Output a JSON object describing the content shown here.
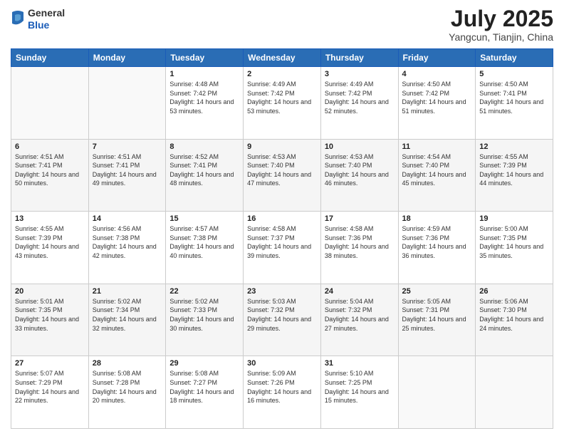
{
  "header": {
    "logo_general": "General",
    "logo_blue": "Blue",
    "month": "July 2025",
    "location": "Yangcun, Tianjin, China"
  },
  "days_of_week": [
    "Sunday",
    "Monday",
    "Tuesday",
    "Wednesday",
    "Thursday",
    "Friday",
    "Saturday"
  ],
  "weeks": [
    [
      {
        "day": "",
        "info": ""
      },
      {
        "day": "",
        "info": ""
      },
      {
        "day": "1",
        "info": "Sunrise: 4:48 AM\nSunset: 7:42 PM\nDaylight: 14 hours and 53 minutes."
      },
      {
        "day": "2",
        "info": "Sunrise: 4:49 AM\nSunset: 7:42 PM\nDaylight: 14 hours and 53 minutes."
      },
      {
        "day": "3",
        "info": "Sunrise: 4:49 AM\nSunset: 7:42 PM\nDaylight: 14 hours and 52 minutes."
      },
      {
        "day": "4",
        "info": "Sunrise: 4:50 AM\nSunset: 7:42 PM\nDaylight: 14 hours and 51 minutes."
      },
      {
        "day": "5",
        "info": "Sunrise: 4:50 AM\nSunset: 7:41 PM\nDaylight: 14 hours and 51 minutes."
      }
    ],
    [
      {
        "day": "6",
        "info": "Sunrise: 4:51 AM\nSunset: 7:41 PM\nDaylight: 14 hours and 50 minutes."
      },
      {
        "day": "7",
        "info": "Sunrise: 4:51 AM\nSunset: 7:41 PM\nDaylight: 14 hours and 49 minutes."
      },
      {
        "day": "8",
        "info": "Sunrise: 4:52 AM\nSunset: 7:41 PM\nDaylight: 14 hours and 48 minutes."
      },
      {
        "day": "9",
        "info": "Sunrise: 4:53 AM\nSunset: 7:40 PM\nDaylight: 14 hours and 47 minutes."
      },
      {
        "day": "10",
        "info": "Sunrise: 4:53 AM\nSunset: 7:40 PM\nDaylight: 14 hours and 46 minutes."
      },
      {
        "day": "11",
        "info": "Sunrise: 4:54 AM\nSunset: 7:40 PM\nDaylight: 14 hours and 45 minutes."
      },
      {
        "day": "12",
        "info": "Sunrise: 4:55 AM\nSunset: 7:39 PM\nDaylight: 14 hours and 44 minutes."
      }
    ],
    [
      {
        "day": "13",
        "info": "Sunrise: 4:55 AM\nSunset: 7:39 PM\nDaylight: 14 hours and 43 minutes."
      },
      {
        "day": "14",
        "info": "Sunrise: 4:56 AM\nSunset: 7:38 PM\nDaylight: 14 hours and 42 minutes."
      },
      {
        "day": "15",
        "info": "Sunrise: 4:57 AM\nSunset: 7:38 PM\nDaylight: 14 hours and 40 minutes."
      },
      {
        "day": "16",
        "info": "Sunrise: 4:58 AM\nSunset: 7:37 PM\nDaylight: 14 hours and 39 minutes."
      },
      {
        "day": "17",
        "info": "Sunrise: 4:58 AM\nSunset: 7:36 PM\nDaylight: 14 hours and 38 minutes."
      },
      {
        "day": "18",
        "info": "Sunrise: 4:59 AM\nSunset: 7:36 PM\nDaylight: 14 hours and 36 minutes."
      },
      {
        "day": "19",
        "info": "Sunrise: 5:00 AM\nSunset: 7:35 PM\nDaylight: 14 hours and 35 minutes."
      }
    ],
    [
      {
        "day": "20",
        "info": "Sunrise: 5:01 AM\nSunset: 7:35 PM\nDaylight: 14 hours and 33 minutes."
      },
      {
        "day": "21",
        "info": "Sunrise: 5:02 AM\nSunset: 7:34 PM\nDaylight: 14 hours and 32 minutes."
      },
      {
        "day": "22",
        "info": "Sunrise: 5:02 AM\nSunset: 7:33 PM\nDaylight: 14 hours and 30 minutes."
      },
      {
        "day": "23",
        "info": "Sunrise: 5:03 AM\nSunset: 7:32 PM\nDaylight: 14 hours and 29 minutes."
      },
      {
        "day": "24",
        "info": "Sunrise: 5:04 AM\nSunset: 7:32 PM\nDaylight: 14 hours and 27 minutes."
      },
      {
        "day": "25",
        "info": "Sunrise: 5:05 AM\nSunset: 7:31 PM\nDaylight: 14 hours and 25 minutes."
      },
      {
        "day": "26",
        "info": "Sunrise: 5:06 AM\nSunset: 7:30 PM\nDaylight: 14 hours and 24 minutes."
      }
    ],
    [
      {
        "day": "27",
        "info": "Sunrise: 5:07 AM\nSunset: 7:29 PM\nDaylight: 14 hours and 22 minutes."
      },
      {
        "day": "28",
        "info": "Sunrise: 5:08 AM\nSunset: 7:28 PM\nDaylight: 14 hours and 20 minutes."
      },
      {
        "day": "29",
        "info": "Sunrise: 5:08 AM\nSunset: 7:27 PM\nDaylight: 14 hours and 18 minutes."
      },
      {
        "day": "30",
        "info": "Sunrise: 5:09 AM\nSunset: 7:26 PM\nDaylight: 14 hours and 16 minutes."
      },
      {
        "day": "31",
        "info": "Sunrise: 5:10 AM\nSunset: 7:25 PM\nDaylight: 14 hours and 15 minutes."
      },
      {
        "day": "",
        "info": ""
      },
      {
        "day": "",
        "info": ""
      }
    ]
  ]
}
